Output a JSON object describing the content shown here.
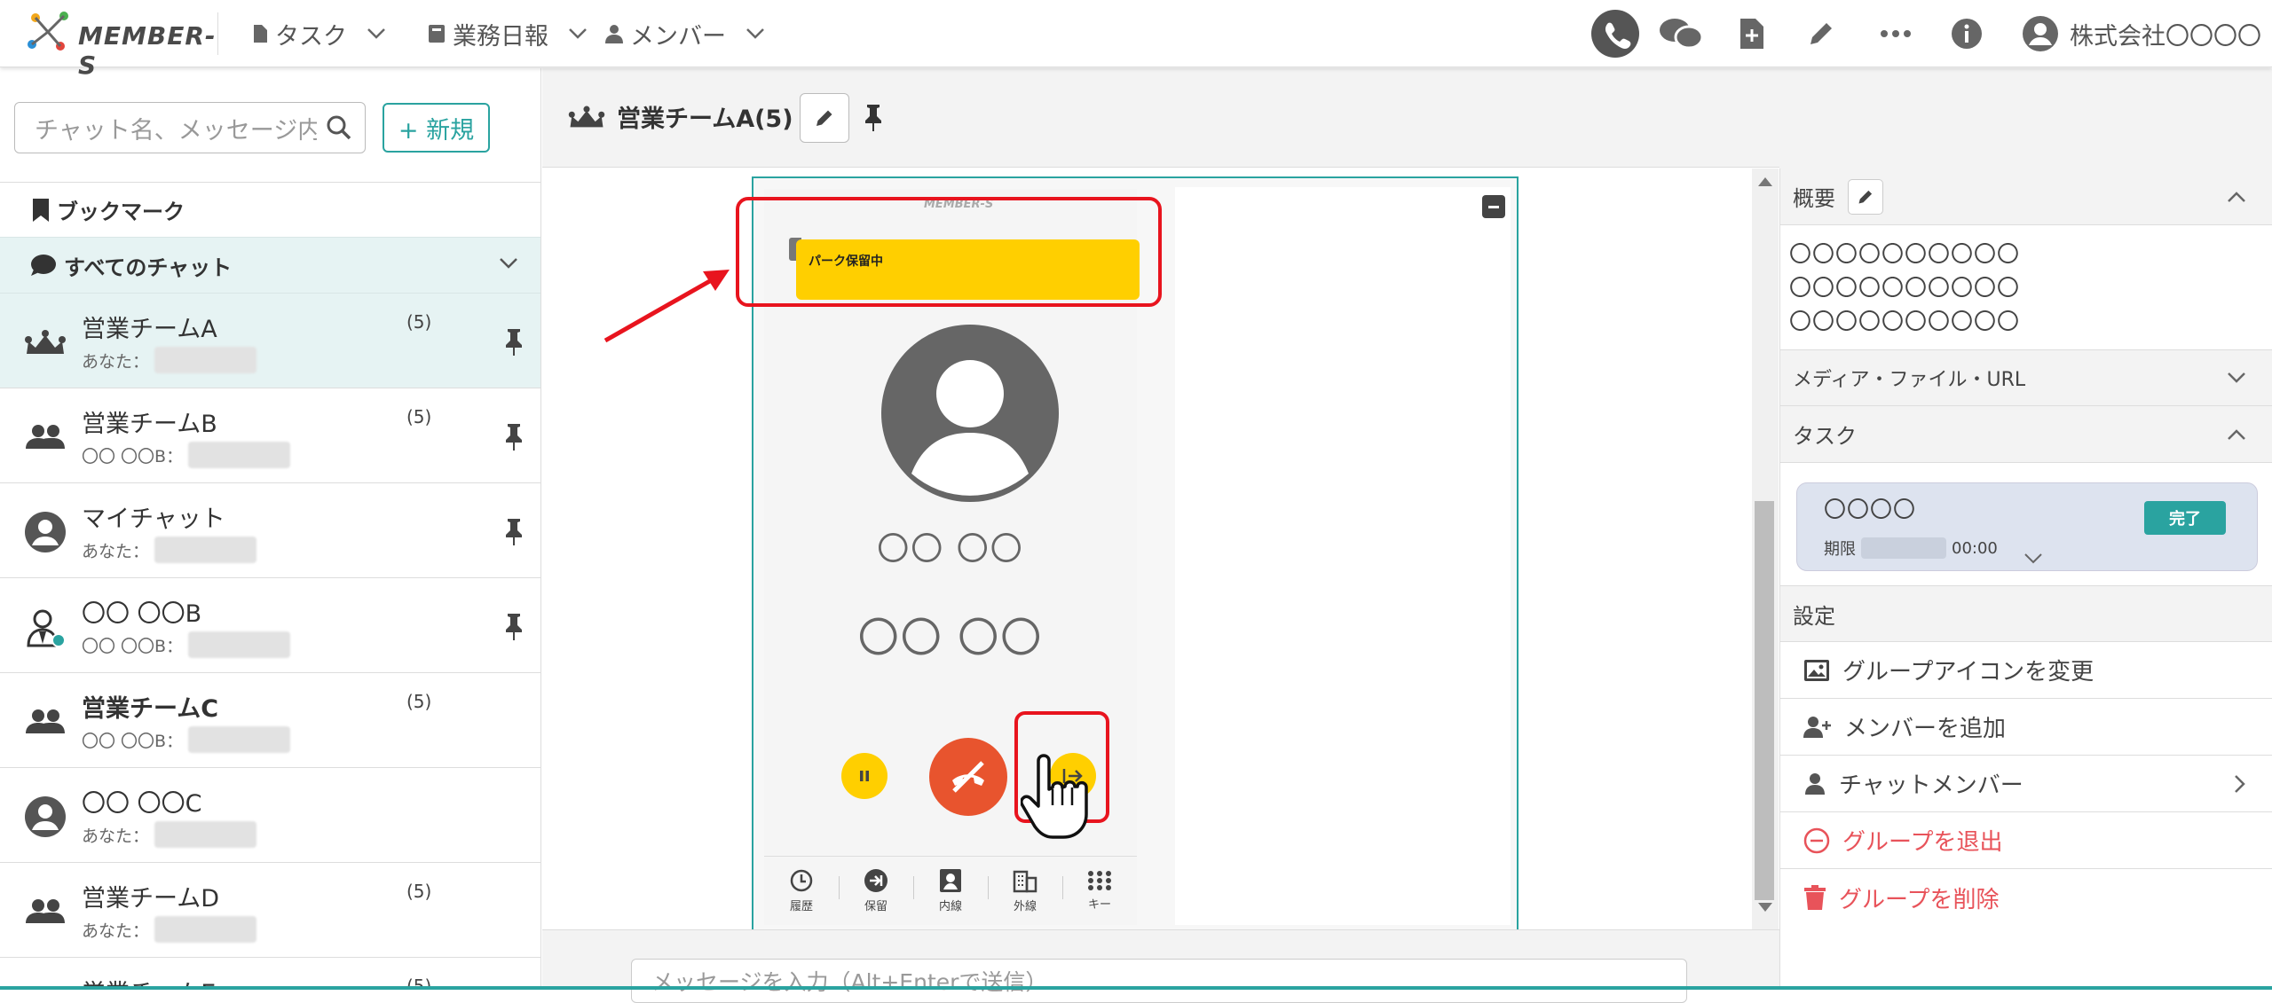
{
  "app": {
    "brand": "MEMBER-S"
  },
  "nav": {
    "task": "タスク",
    "report": "業務日報",
    "member": "メンバー",
    "company": "株式会社〇〇〇〇"
  },
  "sidebar": {
    "search_placeholder": "チャット名、メッセージ内容",
    "new_label": "+ 新規",
    "bookmark_label": "ブックマーク",
    "all_chats_label": "すべてのチャット",
    "chats": [
      {
        "name": "営業チームA",
        "sender": "あなた：",
        "count": "(5)",
        "icon": "crown-group-icon",
        "pinned": true
      },
      {
        "name": "営業チームB",
        "sender": "〇〇 〇〇B：",
        "count": "(5)",
        "icon": "group-icon",
        "pinned": true
      },
      {
        "name": "マイチャット",
        "sender": "あなた：",
        "count": "",
        "icon": "person-icon",
        "pinned": true
      },
      {
        "name": "〇〇 〇〇B",
        "sender": "〇〇 〇〇B：",
        "count": "",
        "icon": "person-photo-icon",
        "pinned": true
      },
      {
        "name": "営業チームC",
        "sender": "〇〇 〇〇B：",
        "count": "(5)",
        "icon": "group-icon",
        "pinned": false
      },
      {
        "name": "〇〇 〇〇C",
        "sender": "あなた：",
        "count": "",
        "icon": "person-icon",
        "pinned": false
      },
      {
        "name": "営業チームD",
        "sender": "あなた：",
        "count": "(5)",
        "icon": "group-icon",
        "pinned": false
      },
      {
        "name": "営業チームE",
        "sender": "",
        "count": "(5)",
        "icon": "group-icon",
        "pinned": false
      }
    ]
  },
  "chat": {
    "title": "営業チームA(5)",
    "member_count": "5",
    "message_placeholder": "メッセージを入力（Alt+Enterで送信）"
  },
  "phone": {
    "park_status": "パーク保留中",
    "caller_line1": "〇〇 〇〇",
    "caller_line2": "〇〇 〇〇",
    "nav": [
      "履歴",
      "保留",
      "内線",
      "外線",
      "キー"
    ]
  },
  "info": {
    "overview_label": "概要",
    "overview_lines": [
      "〇〇〇〇〇〇〇〇〇〇",
      "〇〇〇〇〇〇〇〇〇〇",
      "〇〇〇〇〇〇〇〇〇〇"
    ],
    "media_label": "メディア・ファイル・URL",
    "task_label": "タスク",
    "task_title": "〇〇〇〇",
    "task_deadline_label": "期限",
    "task_deadline_time": "00:00",
    "task_done_label": "完了",
    "settings_label": "設定",
    "settings_items": [
      "グループアイコンを変更",
      "メンバーを追加",
      "チャットメンバー",
      "グループを退出",
      "グループを削除"
    ]
  },
  "colors": {
    "accent": "#2aa3a0",
    "park": "#ffcf00",
    "hangup": "#e8542e",
    "annotation": "#e8141e",
    "danger": "#e8535a"
  }
}
